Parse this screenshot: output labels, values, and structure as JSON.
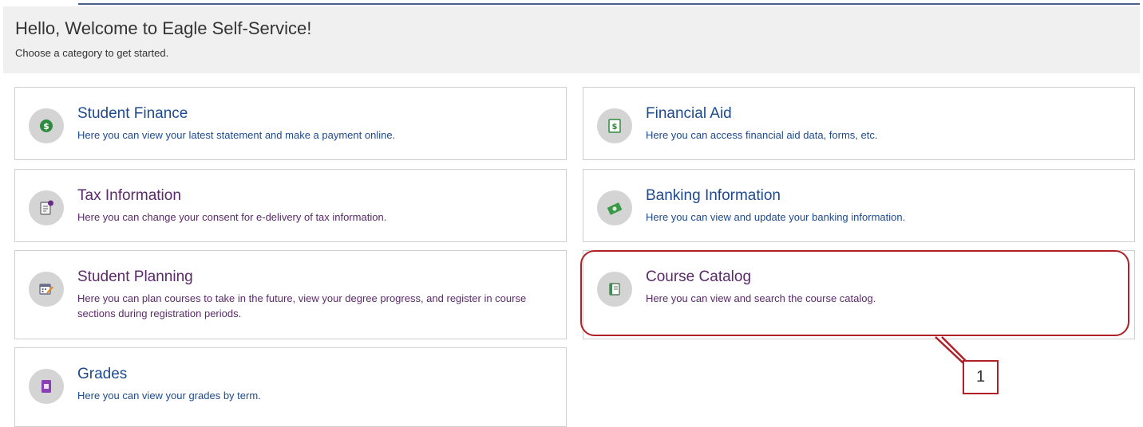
{
  "header": {
    "title": "Hello, Welcome to Eagle Self-Service!",
    "subtitle": "Choose a category to get started."
  },
  "cards": [
    {
      "title": "Student Finance",
      "description": "Here you can view your latest statement and make a payment online.",
      "icon": "dollar-coin-icon"
    },
    {
      "title": "Financial Aid",
      "description": "Here you can access financial aid data, forms, etc.",
      "icon": "money-document-icon"
    },
    {
      "title": "Tax Information",
      "description": "Here you can change your consent for e-delivery of tax information.",
      "icon": "tax-document-icon"
    },
    {
      "title": "Banking Information",
      "description": "Here you can view and update your banking information.",
      "icon": "money-stack-icon"
    },
    {
      "title": "Student Planning",
      "description": "Here you can plan courses to take in the future, view your degree progress, and register in course sections during registration periods.",
      "icon": "calendar-pencil-icon"
    },
    {
      "title": "Course Catalog",
      "description": "Here you can view and search the course catalog.",
      "icon": "book-icon"
    },
    {
      "title": "Grades",
      "description": "Here you can view your grades by term.",
      "icon": "grade-report-icon"
    }
  ],
  "callout": {
    "label": "1",
    "color": "#b02026"
  },
  "colors": {
    "link_blue": "#1d4a8f",
    "link_purple": "#5a2a6a",
    "icon_circle": "#d4d4d4",
    "header_bg": "#f0f0f0"
  }
}
